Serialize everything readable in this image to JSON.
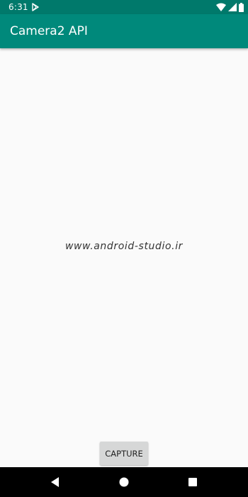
{
  "status_bar": {
    "time": "6:31",
    "icons": [
      "play-store-notification-icon",
      "wifi-icon",
      "cellular-signal-icon",
      "battery-icon"
    ]
  },
  "app_bar": {
    "title": "Camera2 API"
  },
  "content": {
    "watermark": "www.android-studio.ir"
  },
  "capture": {
    "label": "CAPTURE"
  },
  "nav_bar": {
    "icons": [
      "back-icon",
      "home-icon",
      "recents-icon"
    ]
  },
  "colors": {
    "status_bar": "#00796b",
    "app_bar": "#00897b",
    "background": "#fafafa",
    "button": "#d6d7d7",
    "nav_bar": "#000000"
  }
}
